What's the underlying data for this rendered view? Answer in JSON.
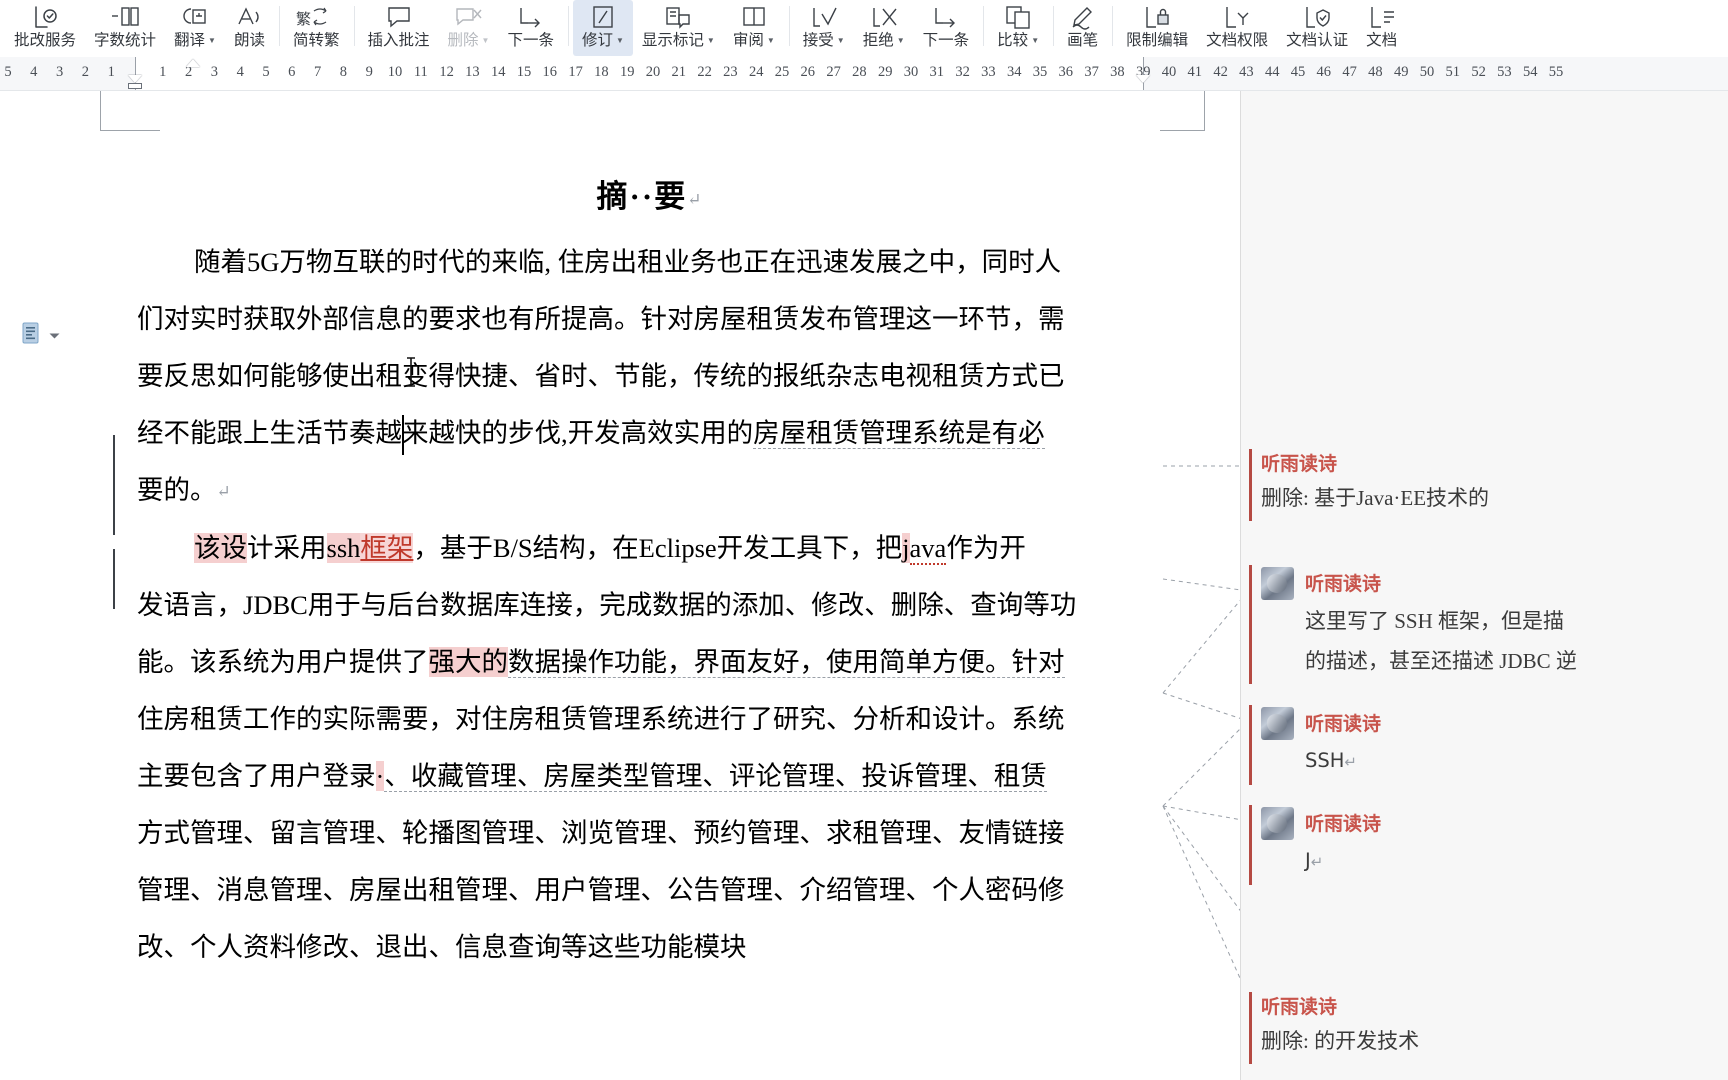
{
  "ribbon": {
    "groups": [
      {
        "name": "proofing",
        "items": [
          {
            "label": "批改服务",
            "icon": "doc-check-icon",
            "caret": false,
            "disabled": false,
            "active": false
          },
          {
            "label": "字数统计",
            "icon": "word-count-icon",
            "caret": false,
            "disabled": false,
            "active": false
          },
          {
            "label": "翻译",
            "icon": "translate-icon",
            "caret": true,
            "disabled": false,
            "active": false
          },
          {
            "label": "朗读",
            "icon": "read-aloud-icon",
            "caret": false,
            "disabled": false,
            "active": false
          }
        ]
      },
      {
        "name": "chinese-conversion",
        "items": [
          {
            "label": "简转繁",
            "icon": "simplified-to-traditional-icon",
            "caret": false,
            "disabled": false,
            "active": false
          }
        ]
      },
      {
        "name": "comments",
        "items": [
          {
            "label": "插入批注",
            "icon": "insert-comment-icon",
            "caret": false,
            "disabled": false,
            "active": false
          },
          {
            "label": "删除",
            "icon": "delete-comment-icon",
            "caret": true,
            "disabled": true,
            "active": false
          },
          {
            "label": "下一条",
            "icon": "next-comment-icon",
            "caret": false,
            "disabled": false,
            "active": false
          }
        ]
      },
      {
        "name": "tracking",
        "items": [
          {
            "label": "修订",
            "icon": "track-changes-icon",
            "caret": true,
            "disabled": false,
            "active": true
          },
          {
            "label": "显示标记",
            "icon": "show-markup-icon",
            "caret": true,
            "disabled": false,
            "active": false
          },
          {
            "label": "审阅",
            "icon": "reviewing-pane-icon",
            "caret": true,
            "disabled": false,
            "active": false
          }
        ]
      },
      {
        "name": "changes",
        "items": [
          {
            "label": "接受",
            "icon": "accept-change-icon",
            "caret": true,
            "disabled": false,
            "active": false
          },
          {
            "label": "拒绝",
            "icon": "reject-change-icon",
            "caret": true,
            "disabled": false,
            "active": false
          },
          {
            "label": "下一条",
            "icon": "next-change-icon",
            "caret": false,
            "disabled": false,
            "active": false
          }
        ]
      },
      {
        "name": "compare",
        "items": [
          {
            "label": "比较",
            "icon": "compare-docs-icon",
            "caret": true,
            "disabled": false,
            "active": false
          }
        ]
      },
      {
        "name": "ink",
        "items": [
          {
            "label": "画笔",
            "icon": "ink-pen-icon",
            "caret": false,
            "disabled": false,
            "active": false
          }
        ]
      },
      {
        "name": "protect",
        "items": [
          {
            "label": "限制编辑",
            "icon": "restrict-editing-icon",
            "caret": false,
            "disabled": false,
            "active": false
          },
          {
            "label": "文档权限",
            "icon": "doc-permission-icon",
            "caret": false,
            "disabled": false,
            "active": false
          },
          {
            "label": "文档认证",
            "icon": "doc-certify-icon",
            "caret": false,
            "disabled": false,
            "active": false
          },
          {
            "label": "文档",
            "icon": "doc-more-icon",
            "caret": false,
            "disabled": false,
            "active": false
          }
        ]
      }
    ]
  },
  "ruler": {
    "left_ticks": [
      "5",
      "4",
      "3",
      "2",
      "1"
    ],
    "right_ticks": [
      "1",
      "2",
      "3",
      "4",
      "5",
      "6",
      "7",
      "8",
      "9",
      "10",
      "11",
      "12",
      "13",
      "14",
      "15",
      "16",
      "17",
      "18",
      "19",
      "20",
      "21",
      "22",
      "23",
      "24",
      "25",
      "26",
      "27",
      "28",
      "29",
      "30",
      "31",
      "32",
      "33",
      "34",
      "35",
      "36",
      "37",
      "38",
      "39",
      "40",
      "41",
      "42",
      "43",
      "44",
      "45",
      "46",
      "47",
      "48",
      "49",
      "50",
      "51",
      "52",
      "53",
      "54",
      "55"
    ],
    "first_line_indent_tick": "2",
    "right_margin_tick": "39"
  },
  "document": {
    "title": "摘 要",
    "title_sep": "·",
    "title_pilcrow": "↵",
    "paragraphs": [
      {
        "id": "p1",
        "lines": [
          {
            "segs": [
              {
                "t": "随着5G万物互联的时代的来临, 住房出租业务也正在迅速发展之中，同时人",
                "s": "plain"
              }
            ],
            "indent": true
          },
          {
            "segs": [
              {
                "t": "们对实时获取外部信息的要求也有所提高。针对房屋租赁发布管理这一环节，需",
                "s": "plain"
              }
            ],
            "indent": false
          },
          {
            "segs": [
              {
                "t": "要反思如何能够使出租变得快捷、省时、节能，传统的报纸杂志电视租赁方式已",
                "s": "plain"
              }
            ],
            "indent": false
          },
          {
            "segs": [
              {
                "t": "经不能跟上生活节奏越来越快的步伐,开发高效实用的",
                "s": "plain"
              },
              {
                "t": "房屋租赁管理系统是有必",
                "s": "commented"
              }
            ],
            "indent": false
          },
          {
            "segs": [
              {
                "t": "要的。",
                "s": "plain"
              },
              {
                "t": "↵",
                "s": "pilcrow"
              }
            ],
            "indent": false
          }
        ]
      },
      {
        "id": "p2",
        "lines": [
          {
            "segs": [
              {
                "t": "该设",
                "s": "hl"
              },
              {
                "t": "计采用",
                "s": "plain"
              },
              {
                "t": "ssh",
                "s": "hl"
              },
              {
                "t": "框架",
                "s": "ins"
              },
              {
                "t": "，基于B/S结构，在Eclipse开发工具下，把",
                "s": "plain"
              },
              {
                "t": "j",
                "s": "hl"
              },
              {
                "t": "ava",
                "s": "spell"
              },
              {
                "t": "作为开",
                "s": "plain"
              }
            ],
            "indent": true
          },
          {
            "segs": [
              {
                "t": "发语言，JDBC用于与后台数据库连接，完成数据的添加、修改、删除、查询等功",
                "s": "plain"
              }
            ],
            "indent": false
          },
          {
            "segs": [
              {
                "t": "能。该系统为用户提供了",
                "s": "plain"
              },
              {
                "t": "强大的",
                "s": "hl"
              },
              {
                "t": "数据操作功能，界面友好，使用简单方便。针对",
                "s": "commented"
              }
            ],
            "indent": false
          },
          {
            "segs": [
              {
                "t": "住房租赁工作的实际需要，对住房租赁管理系统进行了研究、分析和设计。系统",
                "s": "plain"
              }
            ],
            "indent": false
          },
          {
            "segs": [
              {
                "t": "主要包含了用户登录",
                "s": "plain"
              },
              {
                "t": "·",
                "s": "hl"
              },
              {
                "t": "、收藏管理、房屋类型管理、评论管理、投诉管理、租赁",
                "s": "commented"
              }
            ],
            "indent": false
          },
          {
            "segs": [
              {
                "t": "方式管理、留言管理、轮播图管理、浏览管理、预约管理、求租管理、友情链接",
                "s": "plain"
              }
            ],
            "indent": false
          },
          {
            "segs": [
              {
                "t": "管理、消息管理、房屋出租管理、用户管理、公告管理、介绍管理、个人密码修",
                "s": "plain"
              }
            ],
            "indent": false
          },
          {
            "segs": [
              {
                "t": "改、个人资料修改、退出、信息查询等这些功能模块",
                "s": "plain"
              }
            ],
            "indent": false
          }
        ]
      }
    ]
  },
  "comments": {
    "author": "听雨读诗",
    "items": [
      {
        "id": "c1",
        "author": "听雨读诗",
        "body": "删除: 基于Java·EE技术的",
        "has_avatar": false,
        "style": "serif",
        "eop": ""
      },
      {
        "id": "c2",
        "author": "听雨读诗",
        "body": "这里写了 SSH 框架，但是描",
        "body2": "的描述，甚至还描述 JDBC 逆",
        "has_avatar": true,
        "style": "serif",
        "eop": ""
      },
      {
        "id": "c3",
        "author": "听雨读诗",
        "body": "SSH",
        "has_avatar": true,
        "style": "sans",
        "eop": "↵"
      },
      {
        "id": "c4",
        "author": "听雨读诗",
        "body": "J",
        "has_avatar": true,
        "style": "sans",
        "eop": "↵"
      },
      {
        "id": "c5",
        "author": "听雨读诗",
        "body": "删除: 的开发技术",
        "has_avatar": false,
        "style": "serif",
        "eop": ""
      }
    ]
  },
  "colors": {
    "comment_accent": "#b54a43",
    "comment_author": "#c8544b",
    "highlight": "#f5cfcf",
    "insert_text": "#c0392b",
    "active_button_bg": "#dfe7f3",
    "pane_bg": "#f7f7f7",
    "ruler_bg": "#f6f7f9"
  }
}
